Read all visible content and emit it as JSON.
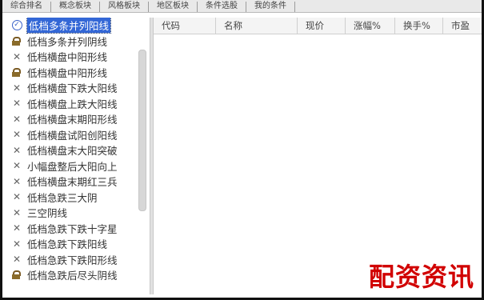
{
  "tabs": [
    {
      "label": "综合排名"
    },
    {
      "label": "概念板块"
    },
    {
      "label": "风格板块"
    },
    {
      "label": "地区板块"
    },
    {
      "label": "条件选股"
    },
    {
      "label": "我的条件"
    }
  ],
  "tree": {
    "items": [
      {
        "icon": "check-icon",
        "label": "低档多条并列阳线",
        "selected": true
      },
      {
        "icon": "lock-icon",
        "label": "低档多条并列阴线"
      },
      {
        "icon": "x-icon",
        "label": "低档横盘中阳形线"
      },
      {
        "icon": "lock-icon",
        "label": "低档横盘中阳形线"
      },
      {
        "icon": "x-icon",
        "label": "低档横盘下跌大阳线"
      },
      {
        "icon": "x-icon",
        "label": "低档横盘上跌大阳线"
      },
      {
        "icon": "x-icon",
        "label": "低档横盘末期阳形线"
      },
      {
        "icon": "x-icon",
        "label": "低档横盘试阳创阳线"
      },
      {
        "icon": "x-icon",
        "label": "低档横盘末大阳突破"
      },
      {
        "icon": "x-icon",
        "label": "小幅盘整后大阳向上"
      },
      {
        "icon": "x-icon",
        "label": "低档横盘末期红三兵"
      },
      {
        "icon": "x-icon",
        "label": "低档急跌三大阴"
      },
      {
        "icon": "x-icon",
        "label": "三空阴线"
      },
      {
        "icon": "x-icon",
        "label": "低档急跌下跌十字星"
      },
      {
        "icon": "x-icon",
        "label": "低档急跌下跌阳线"
      },
      {
        "icon": "x-icon",
        "label": "低档急跌下跌阳形线"
      },
      {
        "icon": "lock-icon",
        "label": "低档急跌后尽头阴线"
      }
    ]
  },
  "grid": {
    "columns": [
      {
        "label": "代码"
      },
      {
        "label": "名称"
      },
      {
        "label": "现价"
      },
      {
        "label": "涨幅%"
      },
      {
        "label": "换手%"
      },
      {
        "label": "市盈"
      }
    ]
  },
  "watermark": {
    "text": "配资资讯",
    "color": "#d10000"
  }
}
